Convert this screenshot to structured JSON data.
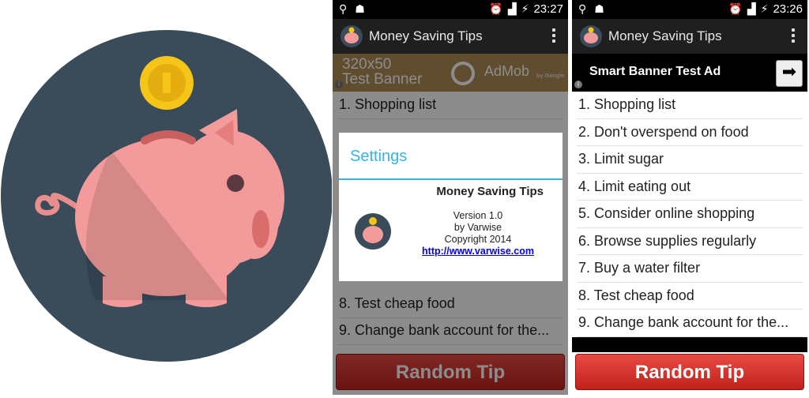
{
  "phones": [
    {
      "status_time": "23:27",
      "app_title": "Money Saving Tips",
      "ad": {
        "line1": "320x50",
        "line2": "Test Banner",
        "brand": "AdMob",
        "brand_sub": "by Google"
      },
      "visible_list": [
        "1. Shopping list",
        "8. Test cheap food",
        "9. Change bank account for the..."
      ],
      "random_button_label": "Random Tip",
      "dialog": {
        "title": "Settings",
        "app_name": "Money Saving Tips",
        "version": "Version 1.0",
        "by": "by Varwise",
        "copyright": "Copyright 2014",
        "link": "http://www.varwise.com"
      }
    },
    {
      "status_time": "23:26",
      "app_title": "Money Saving Tips",
      "ad": {
        "text": "Smart Banner Test Ad"
      },
      "list": [
        "1. Shopping list",
        "2. Don't overspend on food",
        "3. Limit sugar",
        "4. Limit eating out",
        "5. Consider online shopping",
        "6. Browse supplies regularly",
        "7. Buy a water filter",
        "8. Test cheap food",
        "9. Change bank account for the..."
      ],
      "random_button_label": "Random Tip"
    }
  ],
  "colors": {
    "logo_circle": "#3a4b5a",
    "pig": "#f29b9a",
    "coin": "#f5c518",
    "accent": "#33b5e5",
    "button": "#d7312a"
  }
}
